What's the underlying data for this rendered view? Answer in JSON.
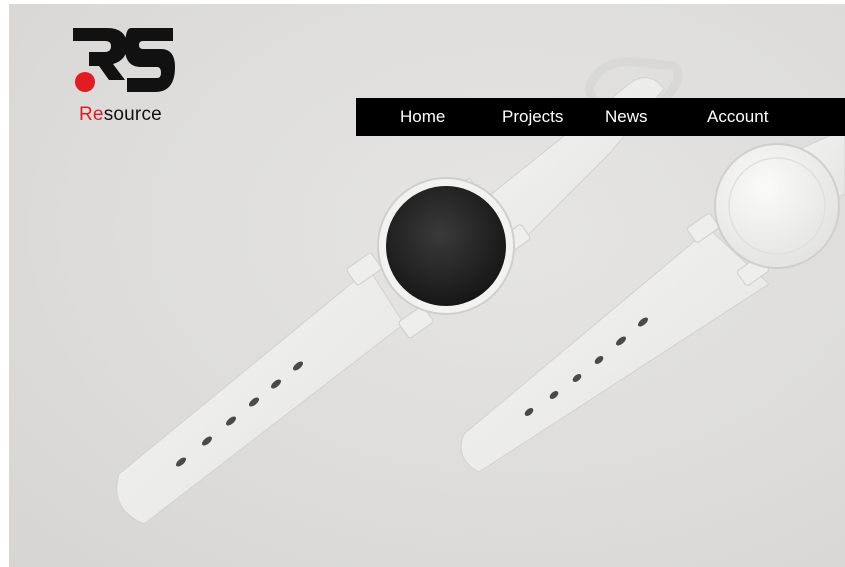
{
  "brand": {
    "logo_mark": "RS",
    "name_accent": "Re",
    "name_rest": "source",
    "accent_color": "#e31b23"
  },
  "nav": {
    "items": [
      {
        "label": "Home"
      },
      {
        "label": "Projects"
      },
      {
        "label": "News"
      },
      {
        "label": "Account"
      }
    ]
  },
  "hero": {
    "subject": "white smartwatch product render"
  }
}
